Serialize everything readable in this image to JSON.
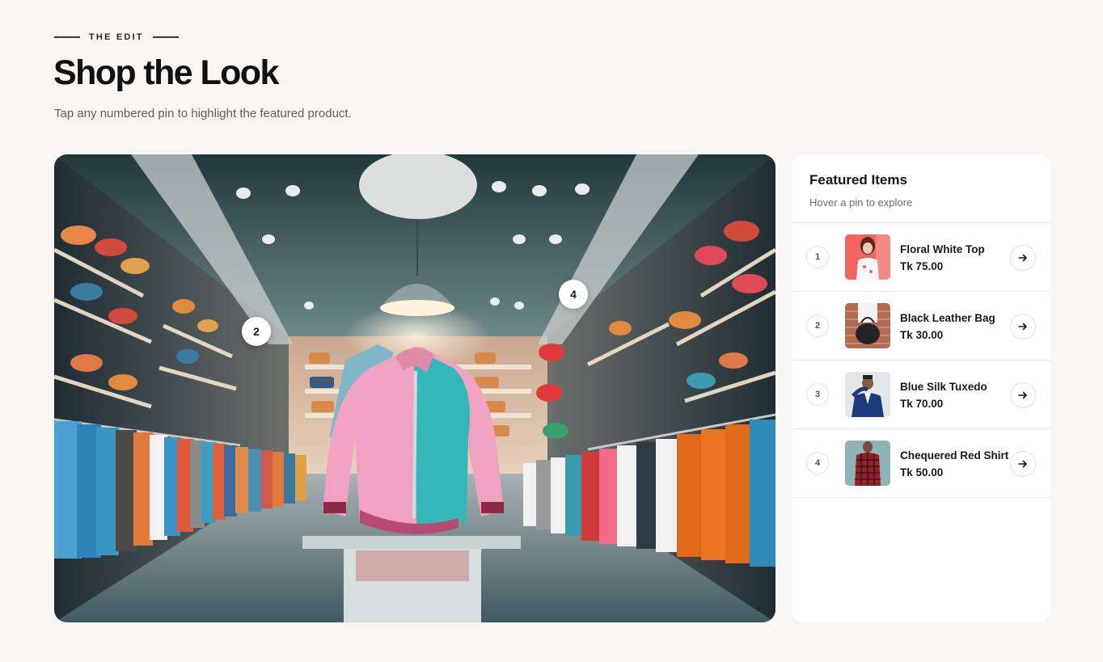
{
  "header": {
    "eyebrow": "THE EDIT",
    "title": "Shop the Look",
    "subtitle": "Tap any numbered pin to highlight the featured product."
  },
  "scene": {
    "pins": [
      {
        "label": "2"
      },
      {
        "label": "4"
      }
    ]
  },
  "panel": {
    "title": "Featured Items",
    "subtitle": "Hover a pin to explore",
    "items": [
      {
        "num": "1",
        "name": "Floral White Top",
        "price": "Tk 75.00",
        "icon": "floral-top-photo"
      },
      {
        "num": "2",
        "name": "Black Leather Bag",
        "price": "Tk 30.00",
        "icon": "leather-bag-photo"
      },
      {
        "num": "3",
        "name": "Blue Silk Tuxedo",
        "price": "Tk 70.00",
        "icon": "tuxedo-photo"
      },
      {
        "num": "4",
        "name": "Chequered Red Shirt",
        "price": "Tk 50.00",
        "icon": "checked-shirt-photo"
      }
    ]
  },
  "colors": {
    "background": "#f7f6f4",
    "panel": "#ffffff",
    "text": "#161616",
    "muted": "#6d6d6d"
  }
}
